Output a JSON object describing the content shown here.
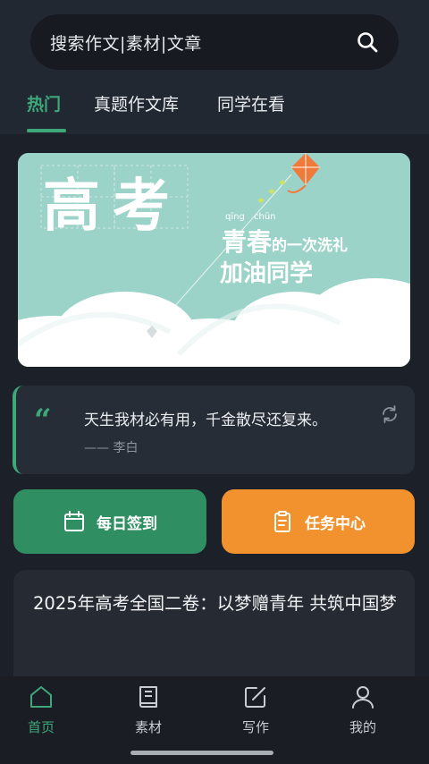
{
  "search": {
    "text": "搜索作文|素材|文章"
  },
  "tabs": [
    {
      "label": "热门",
      "active": true
    },
    {
      "label": "真题作文库",
      "active": false
    },
    {
      "label": "同学在看",
      "active": false
    }
  ],
  "banner": {
    "title": "高考",
    "pinyin_1": "qīng",
    "pinyin_2": "chūn",
    "line1_big": "青春",
    "line1_small": "的一次洗礼",
    "line2": "加油同学"
  },
  "quote": {
    "text": "天生我材必有用，千金散尽还复来。",
    "author": "—— 李白"
  },
  "actions": {
    "sign_label": "每日签到",
    "task_label": "任务中心"
  },
  "article": {
    "title": "2025年高考全国二卷：以梦赠青年 共筑中国梦"
  },
  "nav": [
    {
      "label": "首页",
      "icon": "home-icon",
      "active": true
    },
    {
      "label": "素材",
      "icon": "book-icon",
      "active": false
    },
    {
      "label": "写作",
      "icon": "edit-icon",
      "active": false
    },
    {
      "label": "我的",
      "icon": "user-icon",
      "active": false
    }
  ],
  "colors": {
    "accent": "#3ea87a",
    "sign_button": "#2f8f62",
    "task_button": "#f2922e",
    "background": "#1c2129"
  }
}
